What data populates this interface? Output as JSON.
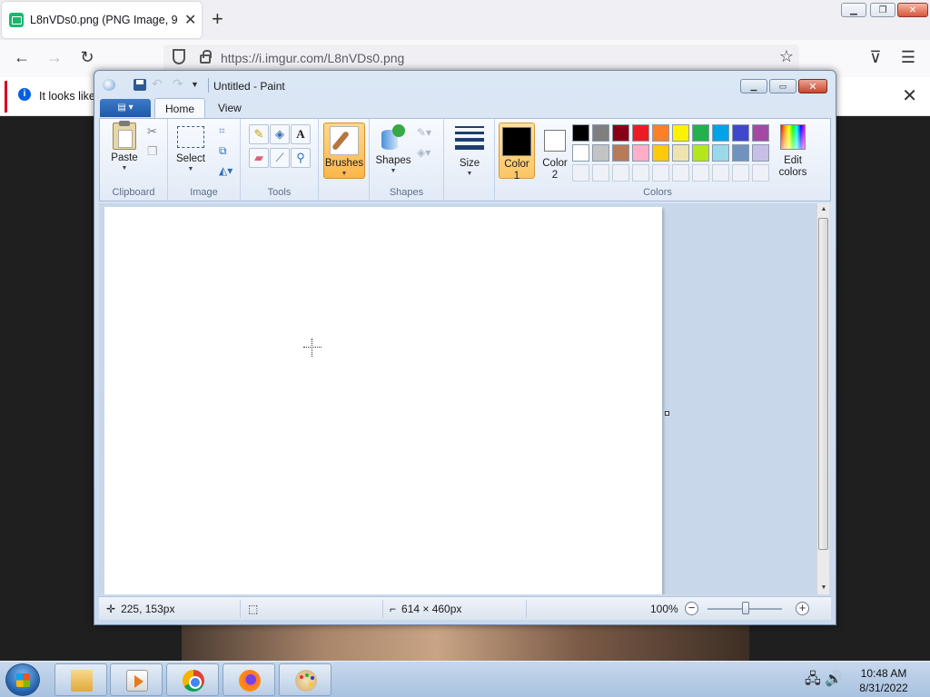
{
  "browser": {
    "tab_title": "L8nVDs0.png (PNG Image, 935",
    "url": "https://i.imgur.com/L8nVDs0.png",
    "notice": "It looks like"
  },
  "paint": {
    "window_title": "Untitled - Paint",
    "tabs": [
      "Home",
      "View"
    ],
    "groups": {
      "clipboard": "Clipboard",
      "image": "Image",
      "tools": "Tools",
      "shapes": "Shapes",
      "colors": "Colors"
    },
    "buttons": {
      "paste": "Paste",
      "select": "Select",
      "brushes": "Brushes",
      "shapes": "Shapes",
      "size": "Size",
      "color1": "Color\n1",
      "color2": "Color\n2",
      "edit_colors": "Edit\ncolors"
    },
    "color1": "#000000",
    "color2": "#ffffff",
    "palette_row1": [
      "#000000",
      "#7f7f7f",
      "#880015",
      "#ed1c24",
      "#ff7f27",
      "#fff200",
      "#22b14c",
      "#00a2e8",
      "#3f48cc",
      "#a349a4"
    ],
    "palette_row2": [
      "#ffffff",
      "#c3c3c3",
      "#b97a57",
      "#ffaec9",
      "#ffc90e",
      "#efe4b0",
      "#b5e61d",
      "#99d9ea",
      "#7092be",
      "#c8bfe7"
    ],
    "status": {
      "cursor_pos": "225, 153px",
      "canvas_size": "614 × 460px",
      "zoom": "100%"
    }
  },
  "taskbar": {
    "time": "10:48 AM",
    "date": "8/31/2022"
  }
}
